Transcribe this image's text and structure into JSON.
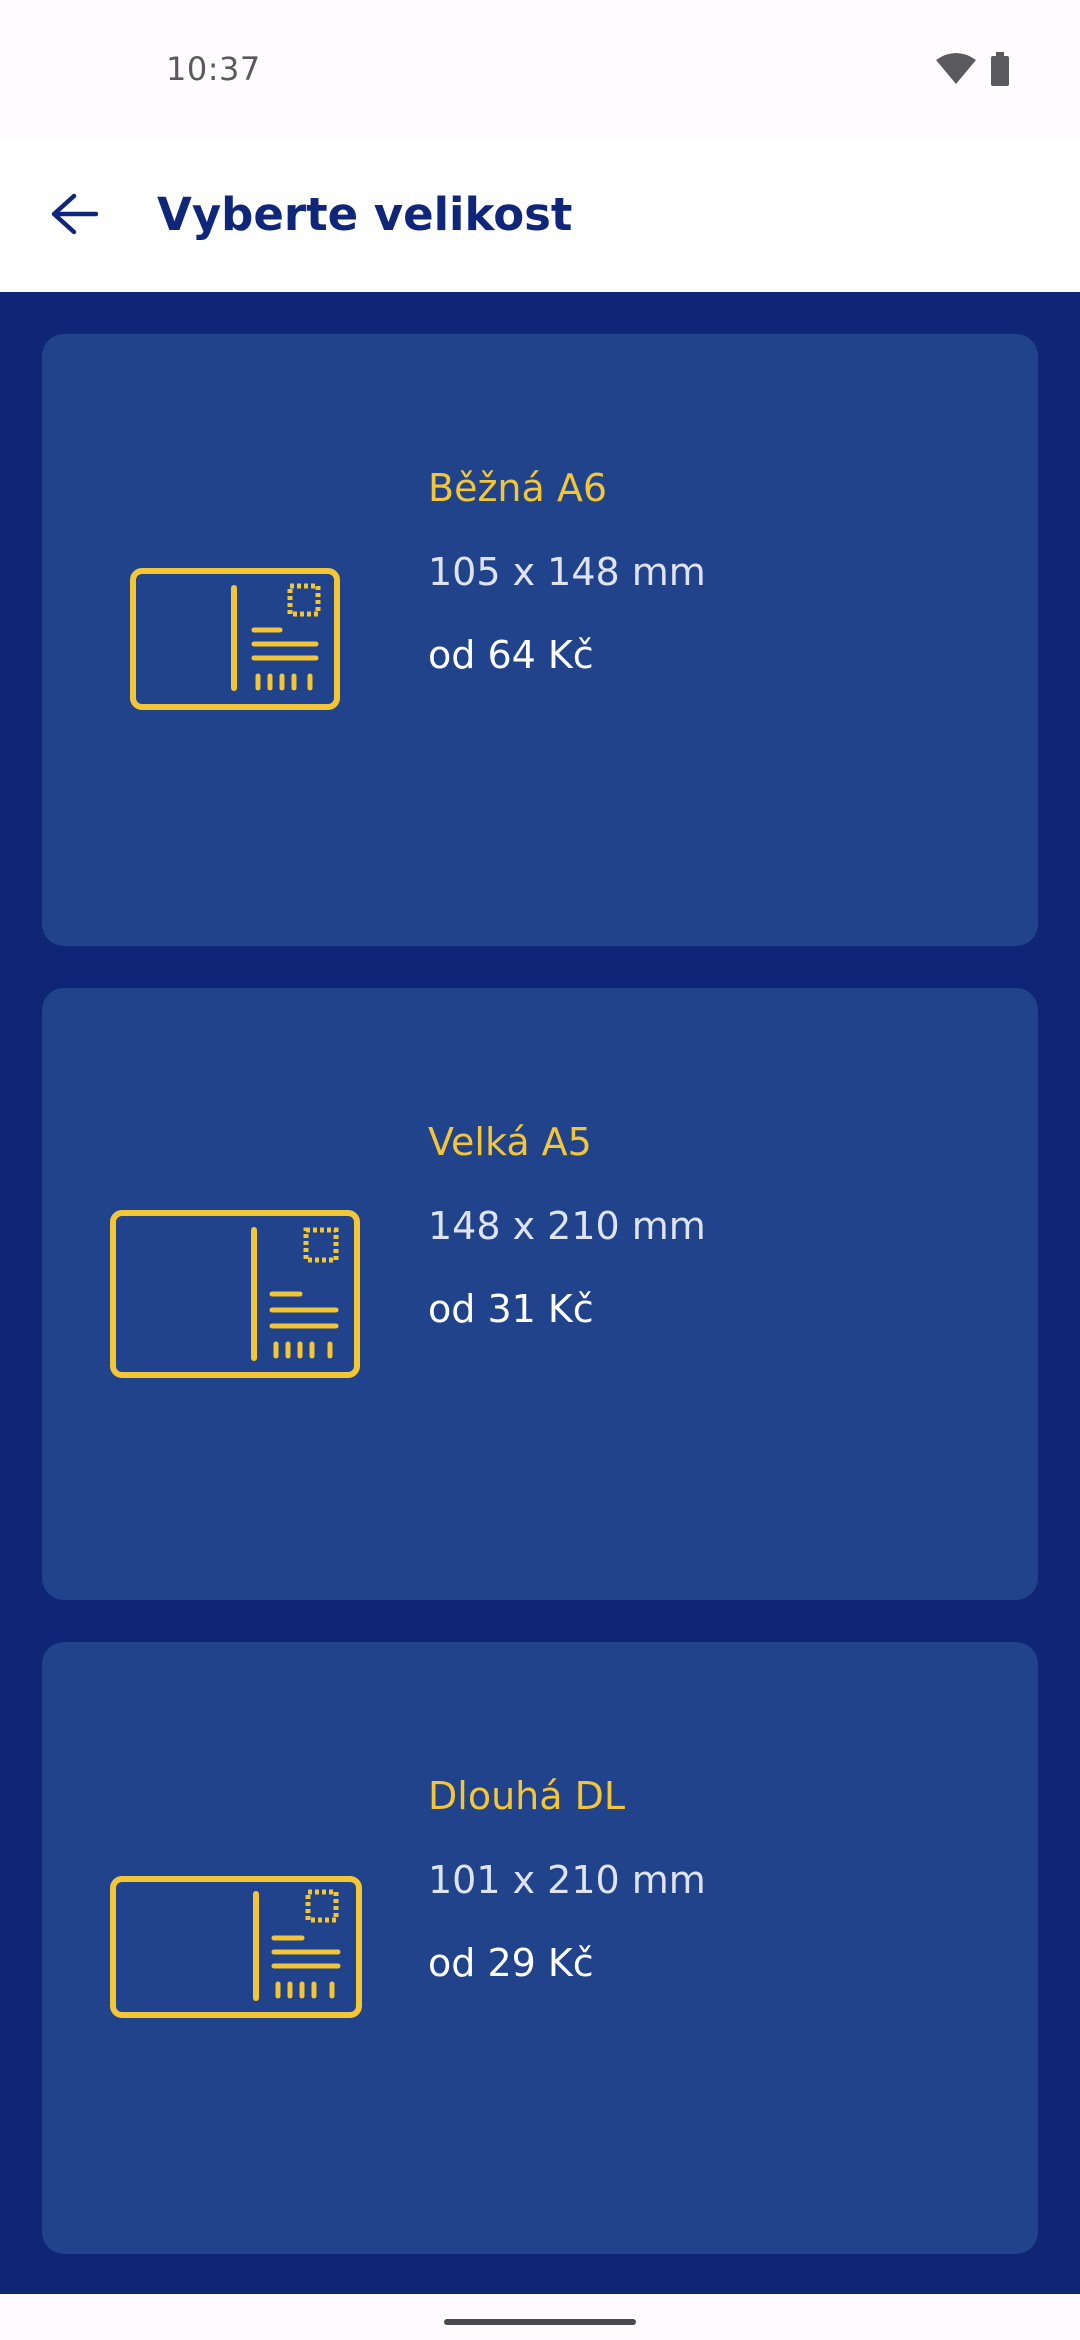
{
  "status_bar": {
    "time": "10:37",
    "icons": [
      "wifi-icon",
      "battery-icon"
    ]
  },
  "app_bar": {
    "back_icon": "arrow-back-icon",
    "title": "Vyberte velikost"
  },
  "sizes": [
    {
      "title": "Běžná A6",
      "dimensions": "105 x 148 mm",
      "price": "od 64 Kč",
      "icon": "postcard-icon"
    },
    {
      "title": "Velká A5",
      "dimensions": "148 x 210 mm",
      "price": "od 31 Kč",
      "icon": "postcard-icon"
    },
    {
      "title": "Dlouhá DL",
      "dimensions": "101 x 210 mm",
      "price": "od 29 Kč",
      "icon": "postcard-icon"
    }
  ],
  "colors": {
    "primary": "#0f2677",
    "card": "#21438b",
    "accent": "#f3c638",
    "title": "#10267a"
  }
}
